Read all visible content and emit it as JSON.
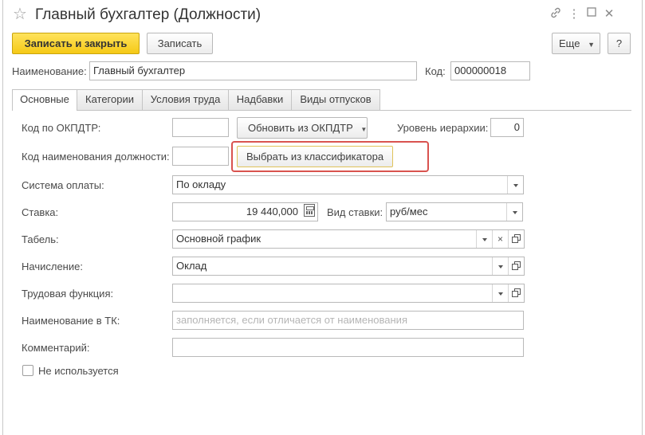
{
  "window": {
    "title": "Главный бухгалтер (Должности)",
    "icons": [
      "star-icon",
      "link-icon",
      "more-icon",
      "maximize-icon",
      "close-icon"
    ]
  },
  "toolbar": {
    "save_close_label": "Записать и закрыть",
    "save_label": "Записать",
    "more_label": "Еще",
    "help_label": "?"
  },
  "header": {
    "name_label": "Наименование:",
    "name_value": "Главный бухгалтер",
    "code_label": "Код:",
    "code_value": "000000018"
  },
  "tabs": [
    {
      "label": "Основные",
      "active": true
    },
    {
      "label": "Категории",
      "active": false
    },
    {
      "label": "Условия труда",
      "active": false
    },
    {
      "label": "Надбавки",
      "active": false
    },
    {
      "label": "Виды отпусков",
      "active": false
    }
  ],
  "form": {
    "okpdtr_label": "Код по ОКПДТР:",
    "okpdtr_value": "",
    "update_okpdtr_label": "Обновить из ОКПДТР",
    "hierarchy_label": "Уровень иерархии:",
    "hierarchy_value": "0",
    "position_code_label": "Код наименования должности:",
    "position_code_value": "",
    "select_classifier_label": "Выбрать из классификатора",
    "payment_system_label": "Система оплаты:",
    "payment_system_value": "По окладу",
    "rate_label": "Ставка:",
    "rate_value": "19 440,000",
    "rate_type_label": "Вид ставки:",
    "rate_type_value": "руб/мес",
    "timesheet_label": "Табель:",
    "timesheet_value": "Основной график",
    "accrual_label": "Начисление:",
    "accrual_value": "Оклад",
    "labor_function_label": "Трудовая функция:",
    "labor_function_value": "",
    "tk_name_label": "Наименование в ТК:",
    "tk_name_placeholder": "заполняется, если отличается от наименования",
    "comment_label": "Комментарий:",
    "comment_value": "",
    "not_used_label": "Не используется",
    "not_used_checked": false
  },
  "colors": {
    "primary_button": "#f5c916",
    "highlight_border": "#d9534f"
  }
}
